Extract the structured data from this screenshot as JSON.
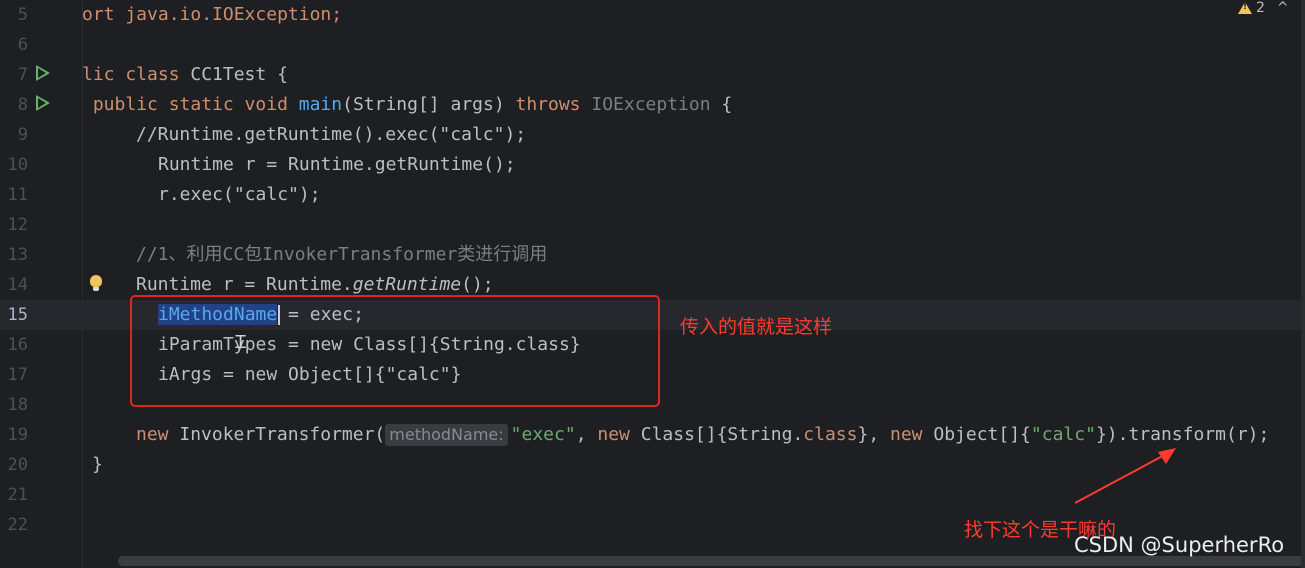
{
  "editor": {
    "lines": [
      {
        "n": "5"
      },
      {
        "n": "6"
      },
      {
        "n": "7"
      },
      {
        "n": "8"
      },
      {
        "n": "9"
      },
      {
        "n": "10"
      },
      {
        "n": "11"
      },
      {
        "n": "12"
      },
      {
        "n": "13"
      },
      {
        "n": "14"
      },
      {
        "n": "15"
      },
      {
        "n": "16"
      },
      {
        "n": "17"
      },
      {
        "n": "18"
      },
      {
        "n": "19"
      },
      {
        "n": "20"
      },
      {
        "n": "21"
      },
      {
        "n": "22"
      }
    ],
    "code": {
      "l5": "ort java.io.IOException;",
      "l7_kw": "lic class ",
      "l7_name": "CC1Test {",
      "l8_indent": " ",
      "l8_kw1": "public static void ",
      "l8_fn": "main",
      "l8_args": "(String[] args) ",
      "l8_throws": "throws ",
      "l8_exc": "IOException",
      "l8_end": " {",
      "l9": "//Runtime.getRuntime().exec(\"calc\");",
      "l10": "Runtime r = Runtime.getRuntime();",
      "l11": "r.exec(\"calc\");",
      "l13": "//1、利用CC包InvokerTransformer类进行调用",
      "l14_a": "Runtime r = Runtime.",
      "l14_it": "getRuntime",
      "l14_b": "();",
      "l15_sel": "iMethodName",
      "l15_rest": " = exec;",
      "l16": "iParamTypes = new Class[]{String.class}",
      "l17": "iArgs = new Object[]{\"calc\"}",
      "l19_new1": "new ",
      "l19_cls": "InvokerTransformer(",
      "l19_hint": "methodName:",
      "l19_str1": "\"exec\"",
      "l19_c1": ", ",
      "l19_new2": "new ",
      "l19_p2": "Class[]{String.",
      "l19_kwclass": "class",
      "l19_p3": "}, ",
      "l19_new3": "new ",
      "l19_p4": "Object[]{",
      "l19_str2": "\"calc\"",
      "l19_p5": "}).transform(r);",
      "l20": "}"
    }
  },
  "status": {
    "warning_count": "2"
  },
  "annotations": {
    "box_note": "传入的值就是这样",
    "arrow_note": "找下这个是干嘛的"
  },
  "watermark": "CSDN @SuperherRo"
}
